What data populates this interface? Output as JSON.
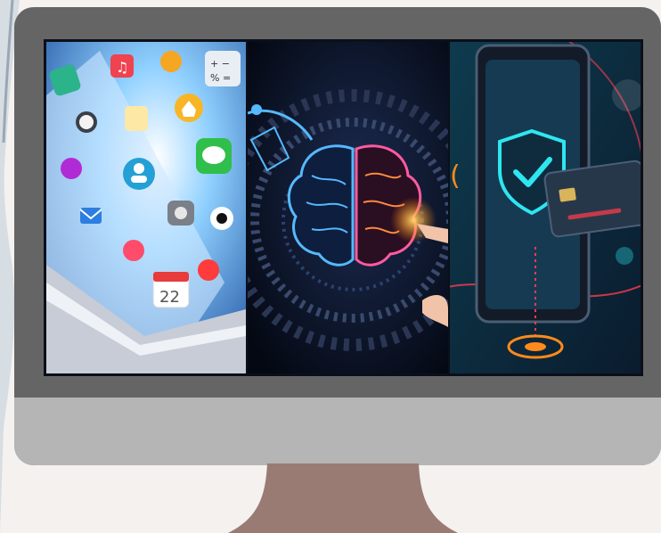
{
  "scene": {
    "description_free": true,
    "monitor_colors": {
      "bezel": "#656565",
      "chin": "#b5b5b5",
      "stand": "#9a7b73",
      "background": "#f4f1ef"
    },
    "panels": [
      {
        "icon": "mobile-apps-illustration",
        "calendar_day": "22"
      },
      {
        "icon": "ai-brain-illustration"
      },
      {
        "icon": "secure-payment-illustration"
      }
    ]
  }
}
